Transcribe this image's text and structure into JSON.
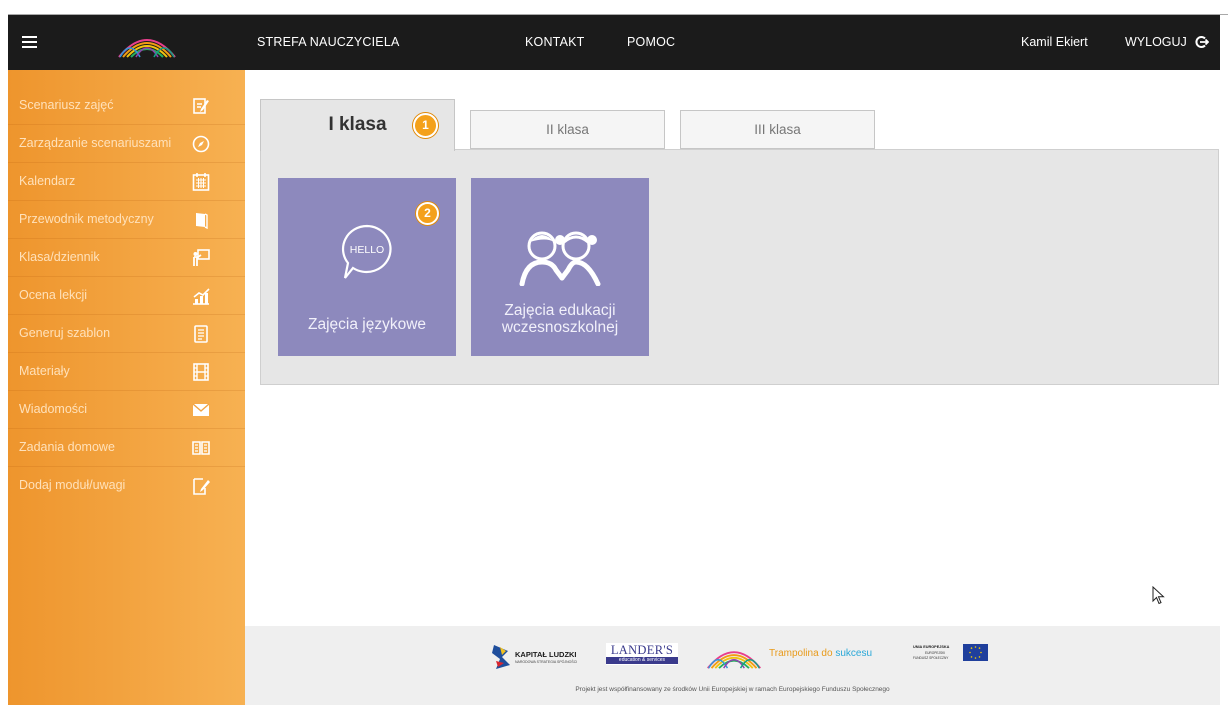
{
  "header": {
    "nav": [
      {
        "label": "STREFA NAUCZYCIELA"
      },
      {
        "label": "KONTAKT"
      },
      {
        "label": "POMOC"
      }
    ],
    "user_name": "Kamil Ekiert",
    "logout_label": "WYLOGUJ"
  },
  "sidebar": {
    "items": [
      {
        "label": "Scenariusz zajęć",
        "icon": "pencil-note-icon"
      },
      {
        "label": "Zarządzanie scenariuszami",
        "icon": "compass-icon"
      },
      {
        "label": "Kalendarz",
        "icon": "calendar-icon"
      },
      {
        "label": "Przewodnik metodyczny",
        "icon": "book-icon"
      },
      {
        "label": "Klasa/dziennik",
        "icon": "teacher-board-icon"
      },
      {
        "label": "Ocena lekcji",
        "icon": "chart-icon"
      },
      {
        "label": "Generuj szablon",
        "icon": "document-icon"
      },
      {
        "label": "Materiały",
        "icon": "film-icon"
      },
      {
        "label": "Wiadomości",
        "icon": "envelope-icon"
      },
      {
        "label": "Zadania domowe",
        "icon": "open-book-icon"
      },
      {
        "label": "Dodaj moduł/uwagi",
        "icon": "edit-note-icon"
      }
    ]
  },
  "tabs": [
    {
      "label": "I klasa",
      "active": true,
      "badge": "1"
    },
    {
      "label": "II klasa",
      "active": false
    },
    {
      "label": "III klasa",
      "active": false
    }
  ],
  "tiles": [
    {
      "label": "Zajęcia językowe",
      "icon": "speech-bubble-icon",
      "icon_text": "HELLO",
      "badge": "2"
    },
    {
      "label_line1": "Zajęcia edukacji",
      "label_line2": "wczesnoszkolnej",
      "icon": "children-icon"
    }
  ],
  "footer": {
    "logos": [
      {
        "name": "kapital-ludzki",
        "text": "KAPITAŁ LUDZKI",
        "subtext": "NARODOWA STRATEGIA SPÓJNOŚCI"
      },
      {
        "name": "landers",
        "text": "LANDER'S",
        "subtext": "education & services"
      },
      {
        "name": "trampolina",
        "text_part1": "Trampolina do",
        "text_part2": "sukcesu"
      },
      {
        "name": "unia-europejska",
        "text": "UNIA EUROPEJSKA",
        "subtext1": "EUROPEJSKI",
        "subtext2": "FUNDUSZ SPOŁECZNY"
      }
    ],
    "note": "Projekt jest współfinansowany ze środków Unii Europejskiej w ramach Europejskiego Funduszu Społecznego"
  },
  "colors": {
    "topbar": "#1b1b1b",
    "sidebar_start": "#ee952d",
    "sidebar_end": "#f7b152",
    "tile": "#8d89bd",
    "badge": "#f4a11b",
    "panel": "#e6e6e6"
  }
}
